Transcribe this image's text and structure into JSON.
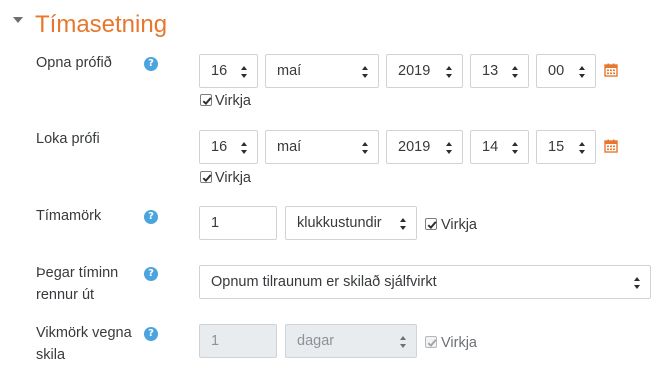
{
  "section": {
    "title": "Tímasetning"
  },
  "open": {
    "label": "Opna prófið",
    "day": "16",
    "month": "maí",
    "year": "2019",
    "hour": "13",
    "minute": "00",
    "enable_label": "Virkja"
  },
  "close": {
    "label": "Loka prófi",
    "day": "16",
    "month": "maí",
    "year": "2019",
    "hour": "14",
    "minute": "15",
    "enable_label": "Virkja"
  },
  "timelimit": {
    "label": "Tímamörk",
    "value": "1",
    "unit": "klukkustundir",
    "enable_label": "Virkja"
  },
  "overdue": {
    "label_line1": "Þegar tíminn",
    "label_line2": "rennur út",
    "value": "Opnum tilraunum er skilað sjálfvirkt"
  },
  "grace": {
    "label_line1": "Vikmörk vegna",
    "label_line2": "skila",
    "value": "1",
    "unit": "dagar",
    "enable_label": "Virkja"
  },
  "icons": {
    "help": "?",
    "help_color": "#4ba4dd",
    "calendar_color": "#e8772e",
    "accent": "#e8772e"
  }
}
